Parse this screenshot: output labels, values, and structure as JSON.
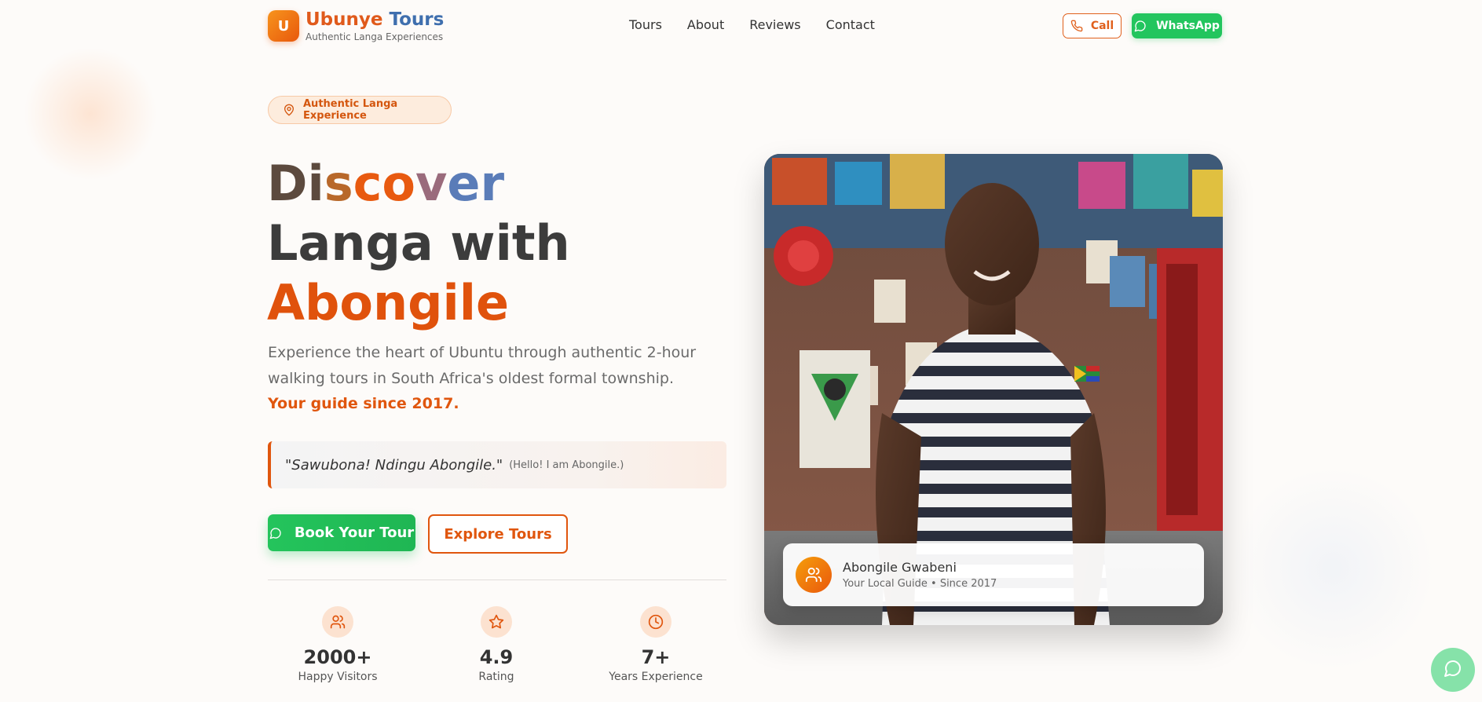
{
  "header": {
    "logo_letter": "U",
    "brand_part1": "Ubunye",
    "brand_part2": "Tours",
    "tagline": "Authentic Langa Experiences",
    "nav": [
      "Tours",
      "About",
      "Reviews",
      "Contact"
    ],
    "call_label": "Call",
    "whatsapp_label": "WhatsApp"
  },
  "hero": {
    "badge": "Authentic Langa Experience",
    "title_line1": [
      "Di",
      "s",
      "co",
      "v",
      "er"
    ],
    "title_line2": "Langa with",
    "title_line3": "Abongile",
    "description": "Experience the heart of Ubuntu through authentic 2-hour walking tours in South Africa's oldest formal township.",
    "since": "Your guide since 2017.",
    "quote": "\"Sawubona! Ndingu Abongile.\"",
    "quote_translation": "(Hello! I am Abongile.)",
    "book_label": "Book Your Tour",
    "explore_label": "Explore Tours"
  },
  "stats": [
    {
      "value": "2000+",
      "label": "Happy Visitors",
      "icon": "users-icon"
    },
    {
      "value": "4.9",
      "label": "Rating",
      "icon": "star-icon"
    },
    {
      "value": "7+",
      "label": "Years Experience",
      "icon": "clock-icon"
    }
  ],
  "guide": {
    "name": "Abongile Gwabeni",
    "subtitle": "Your Local Guide • Since 2017"
  },
  "colors": {
    "accent": "#e0560e",
    "whatsapp": "#22c55e"
  }
}
